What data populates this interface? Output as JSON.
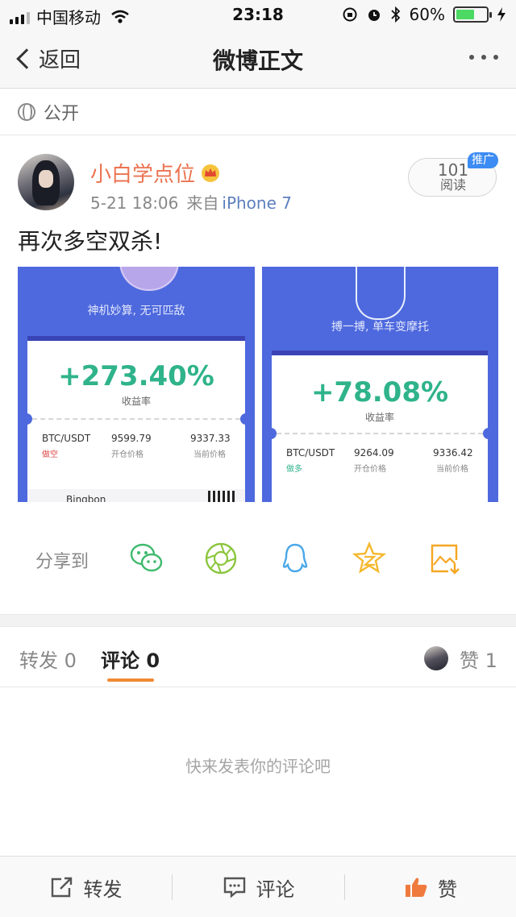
{
  "status_bar": {
    "carrier": "中国移动",
    "time": "23:18",
    "battery": "60%",
    "battery_level": 0.6
  },
  "nav": {
    "back_label": "返回",
    "title": "微博正文"
  },
  "visibility": {
    "label": "公开"
  },
  "post": {
    "author": "小白学点位",
    "time": "5-21 18:06",
    "from_label": "来自",
    "source": "iPhone 7",
    "read_count": "101",
    "read_label": "阅读",
    "promo_tag": "推广",
    "text": "再次多空双杀!"
  },
  "images": [
    {
      "slogan": "神机妙算, 无可匹敌",
      "percent": "+273.40%",
      "percent_label": "收益率",
      "pair": "BTC/USDT",
      "direction": "做空",
      "open_price": "9599.79",
      "open_label": "开仓价格",
      "current_price": "9337.33",
      "current_label": "当前价格",
      "footer_brand": "Bingbon"
    },
    {
      "slogan": "搏一搏, 单车变摩托",
      "percent": "+78.08%",
      "percent_label": "收益率",
      "pair": "BTC/USDT",
      "direction": "做多",
      "open_price": "9264.09",
      "open_label": "开仓价格",
      "current_price": "9336.42",
      "current_label": "当前价格"
    }
  ],
  "share": {
    "label": "分享到",
    "targets": [
      "wechat-icon",
      "moments-icon",
      "qq-icon",
      "qzone-icon",
      "save-image-icon"
    ]
  },
  "tabs": {
    "repost_label": "转发",
    "repost_count": "0",
    "comment_label": "评论",
    "comment_count": "0",
    "like_label": "赞",
    "like_count": "1"
  },
  "empty_hint": "快来发表你的评论吧",
  "toolbar": {
    "repost": "转发",
    "comment": "评论",
    "like": "赞"
  },
  "colors": {
    "accent_orange": "#eb7350",
    "link_blue": "#5d7fbd",
    "tab_underline": "#f08a35",
    "card_blue": "#4e69de",
    "gain_green": "#2fb38a"
  }
}
